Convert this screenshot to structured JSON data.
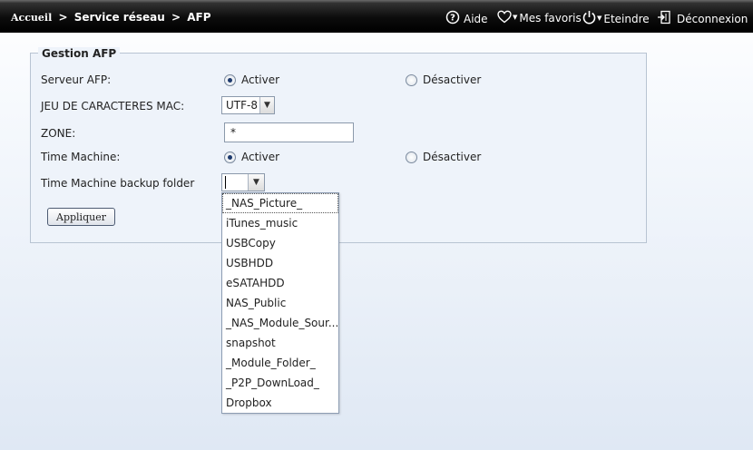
{
  "breadcrumb": {
    "home": "Accueil",
    "separator": ">",
    "section": "Service réseau",
    "page": "AFP"
  },
  "topmenu": {
    "help": "Aide",
    "favorites": "Mes favoris",
    "shutdown": "Eteindre",
    "logout": "Déconnexion"
  },
  "form": {
    "legend": "Gestion AFP",
    "afp_server_label": "Serveur AFP:",
    "afp_enable": "Activer",
    "afp_disable": "Désactiver",
    "afp_selected": "Activer",
    "charset_label": "JEU DE CARACTERES MAC:",
    "charset_value": "UTF-8",
    "zone_label": "ZONE:",
    "zone_value": "*",
    "tm_label": "Time Machine:",
    "tm_enable": "Activer",
    "tm_disable": "Désactiver",
    "tm_selected": "Activer",
    "tm_folder_label": "Time Machine backup folder",
    "tm_folder_value": "",
    "apply_label": "Appliquer"
  },
  "dropdown": {
    "items": [
      "_NAS_Picture_",
      "iTunes_music",
      "USBCopy",
      "USBHDD",
      "eSATAHDD",
      "NAS_Public",
      "_NAS_Module_Sour...",
      "snapshot",
      "_Module_Folder_",
      "_P2P_DownLoad_",
      "Dropbox"
    ],
    "highlighted": "_NAS_Picture_"
  },
  "icons": {
    "help": "help-circle-icon",
    "favorites": "heart-icon",
    "shutdown": "power-icon",
    "logout": "logout-door-icon"
  }
}
